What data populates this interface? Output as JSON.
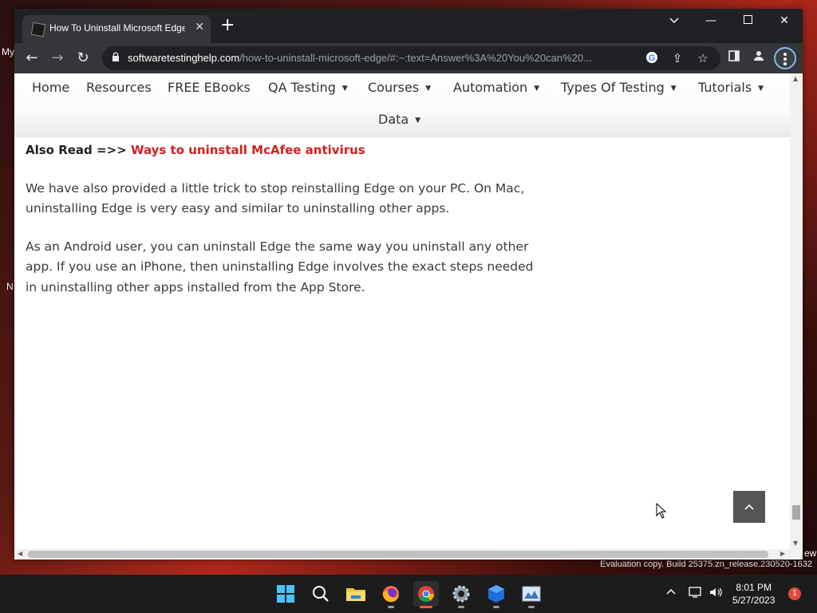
{
  "desktop": {
    "left_text_1": "My",
    "left_text_2": "N",
    "right_text": "ew",
    "watermark": "Evaluation copy. Build 25375.zn_release.230520-1632"
  },
  "browser": {
    "tab_title": "How To Uninstall Microsoft Edge",
    "url_host": "softwaretestinghelp.com",
    "url_path": "/how-to-uninstall-microsoft-edge/#:~:text=Answer%3A%20You%20can%20..."
  },
  "site_nav": {
    "items": [
      {
        "label": "Home"
      },
      {
        "label": "Resources"
      },
      {
        "label": "FREE EBooks"
      },
      {
        "label": "QA Testing"
      },
      {
        "label": "Courses"
      },
      {
        "label": "Automation"
      },
      {
        "label": "Types Of Testing"
      },
      {
        "label": "Tutorials"
      },
      {
        "label": "Data"
      }
    ],
    "caret": "▼"
  },
  "article": {
    "also_read_prefix": "Also Read =>> ",
    "also_read_link": "Ways to uninstall McAfee antivirus",
    "paragraph_1": "We have also provided a little trick to stop reinstalling Edge on your PC. On Mac, uninstalling Edge is very easy and similar to uninstalling other apps.",
    "paragraph_2": "As an Android user, you can uninstall Edge the same way you uninstall any other app. If you use an iPhone, then uninstalling Edge involves the exact steps needed in uninstalling other apps installed from the App Store."
  },
  "taskbar": {
    "time": "8:01 PM",
    "date": "5/27/2023",
    "notification_count": "1"
  },
  "colors": {
    "link_red": "#d21f1f",
    "chrome_dark": "#202124",
    "chrome_toolbar": "#35363a",
    "scroll_top_button": "#555555"
  }
}
